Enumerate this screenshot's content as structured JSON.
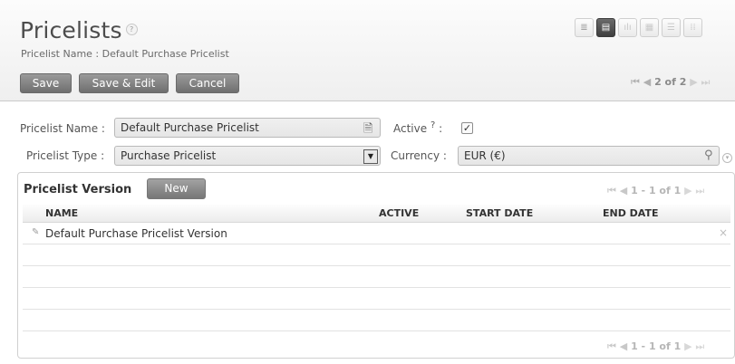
{
  "header": {
    "title": "Pricelists",
    "help_icon": "?",
    "subtitle": "Pricelist Name : Default Purchase Pricelist",
    "views": [
      {
        "icon": "list-view-icon",
        "glyph": "≣"
      },
      {
        "icon": "form-view-icon",
        "glyph": "▤"
      },
      {
        "icon": "graph-view-icon",
        "glyph": "ılı"
      },
      {
        "icon": "calendar-view-icon",
        "glyph": "▦"
      },
      {
        "icon": "gantt-view-icon",
        "glyph": "☰"
      },
      {
        "icon": "kanban-view-icon",
        "glyph": "⁞⁞"
      }
    ]
  },
  "toolbar": {
    "save_label": "Save",
    "save_edit_label": "Save & Edit",
    "cancel_label": "Cancel",
    "pager": {
      "first": "⏮",
      "prev": "◀",
      "text": "2 of 2",
      "next": "▶",
      "last": "⏭"
    }
  },
  "form": {
    "pricelist_name_label": "Pricelist Name :",
    "pricelist_name_value": "Default Purchase Pricelist",
    "active_label": "Active",
    "active_help": "?",
    "active_colon": ":",
    "active_checked": true,
    "pricelist_type_label": "Pricelist Type :",
    "pricelist_type_value": "Purchase Pricelist",
    "currency_label": "Currency :",
    "currency_value": "EUR (€)"
  },
  "version_panel": {
    "title": "Pricelist Version",
    "new_label": "New",
    "pager_text": "1 - 1 of 1",
    "columns": [
      "NAME",
      "ACTIVE",
      "START DATE",
      "END DATE"
    ],
    "rows": [
      {
        "name": "Default Purchase Pricelist Version",
        "active": "",
        "start_date": "",
        "end_date": ""
      }
    ],
    "bottom_pager_text": "1 - 1 of 1"
  },
  "colors": {
    "button_bg": "#7f7f7f",
    "header_bg": "#f4f4f4",
    "active_view": "#4a4a4a"
  }
}
